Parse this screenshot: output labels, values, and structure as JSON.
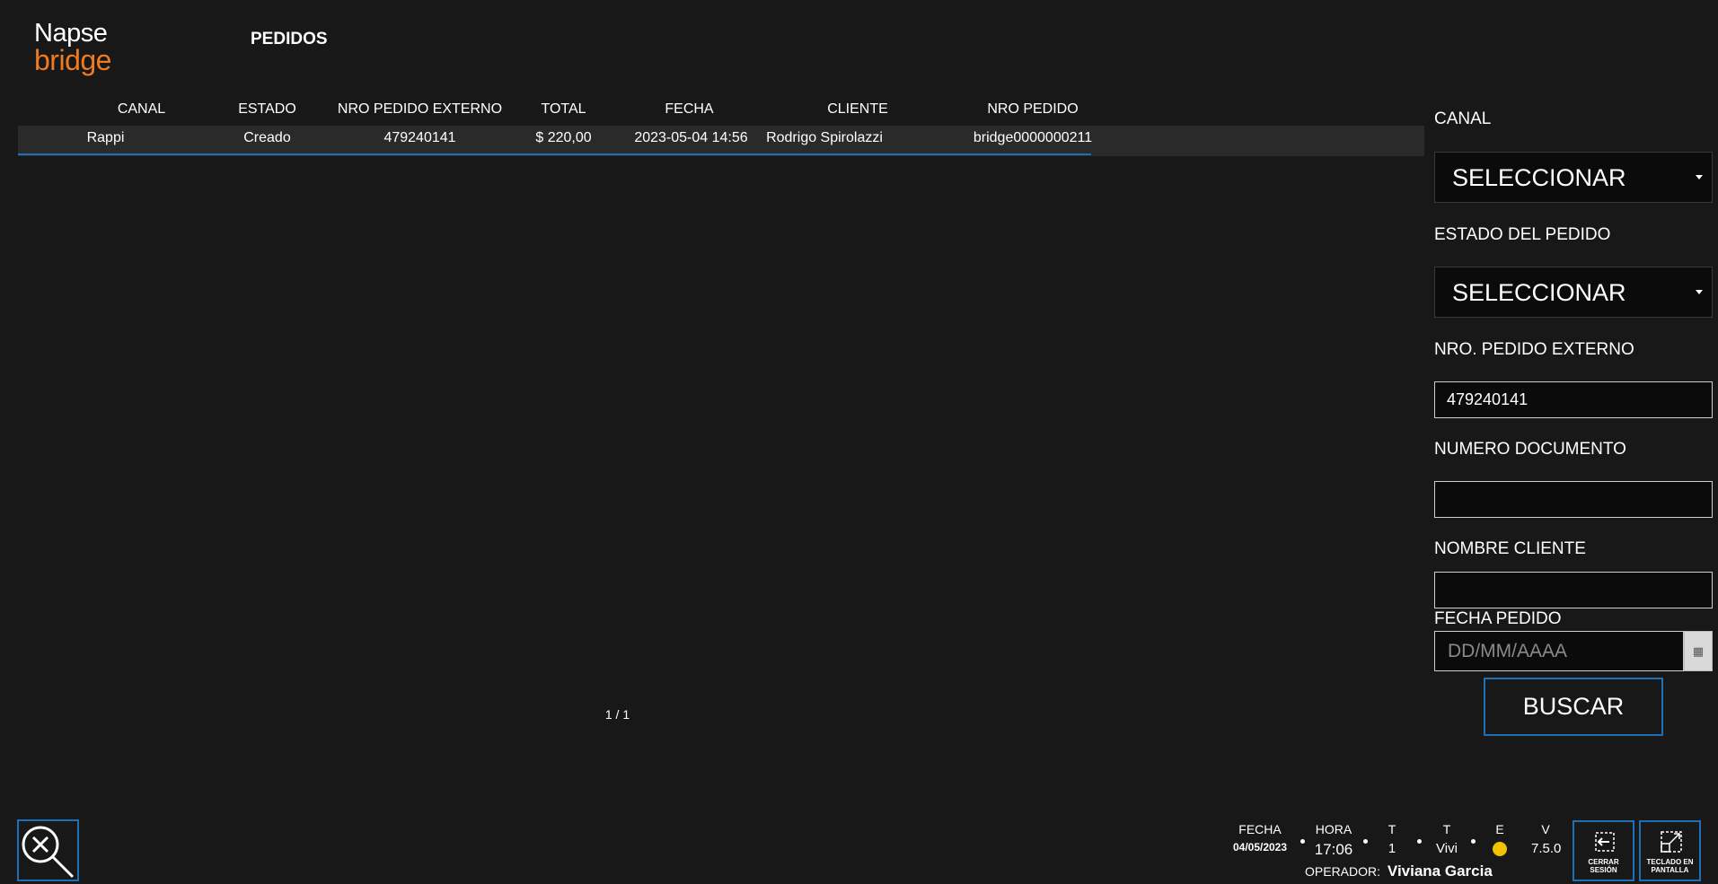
{
  "app": {
    "logo_line1": "Napse",
    "logo_line2": "bridge",
    "page_title": "PEDIDOS"
  },
  "table": {
    "columns": [
      "CANAL",
      "ESTADO",
      "NRO PEDIDO EXTERNO",
      "TOTAL",
      "FECHA",
      "CLIENTE",
      "NRO PEDIDO"
    ],
    "rows": [
      {
        "canal": "Rappi",
        "estado": "Creado",
        "nro_pedido_externo": "479240141",
        "total": "$ 220,00",
        "fecha": "2023-05-04 14:56",
        "cliente": "Rodrigo Spirolazzi",
        "nro_pedido": "bridge0000000211"
      }
    ],
    "pager": "1 / 1"
  },
  "filters": {
    "canal_label": "CANAL",
    "canal_value": "SELECCIONAR",
    "estado_label": "ESTADO DEL PEDIDO",
    "estado_value": "SELECCIONAR",
    "nro_ext_label": "NRO. PEDIDO EXTERNO",
    "nro_ext_value": "479240141",
    "doc_label": "NUMERO DOCUMENTO",
    "doc_value": "",
    "cliente_label": "NOMBRE CLIENTE",
    "cliente_value": "",
    "fecha_label": "FECHA PEDIDO",
    "fecha_placeholder": "DD/MM/AAAA",
    "buscar_label": "BUSCAR"
  },
  "status_bar": {
    "fecha_label": "FECHA",
    "fecha_value": "04/05/2023",
    "hora_label": "HORA",
    "hora_value": "17:06",
    "t1_label": "T",
    "t1_value": "1",
    "t2_label": "T",
    "t2_value": "Vivi",
    "e_label": "E",
    "e_status_color": "#f2c200",
    "v_label": "V",
    "v_value": "7.5.0",
    "operador_label": "OPERADOR:",
    "operador_value": "Viviana Garcia",
    "cerrar_label_1": "CERRAR",
    "cerrar_label_2": "SESIÓN",
    "teclado_label_1": "TECLADO EN",
    "teclado_label_2": "PANTALLA"
  },
  "colors": {
    "background": "#181818",
    "accent": "#1f6fb5",
    "brand": "#ee7b22"
  }
}
